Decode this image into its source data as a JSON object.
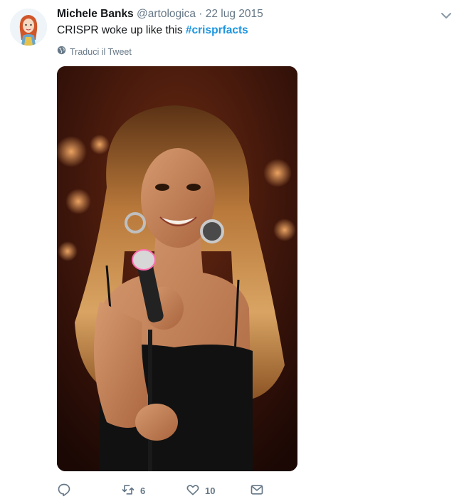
{
  "tweet": {
    "author_name": "Michele Banks",
    "author_handle": "@artologica",
    "separator": " · ",
    "date": "22 lug 2015",
    "text_plain": "CRISPR woke up like this ",
    "hashtag": "#crisprfacts",
    "translate_label": "Traduci il Tweet",
    "retweet_count": "6",
    "like_count": "10"
  },
  "icons": {
    "reply": "reply-icon",
    "retweet": "retweet-icon",
    "like": "heart-icon",
    "message": "envelope-icon",
    "translate": "globe-icon",
    "menu": "chevron-down-icon"
  },
  "colors": {
    "link": "#1b95e0",
    "muted": "#657786",
    "text": "#14171a"
  }
}
